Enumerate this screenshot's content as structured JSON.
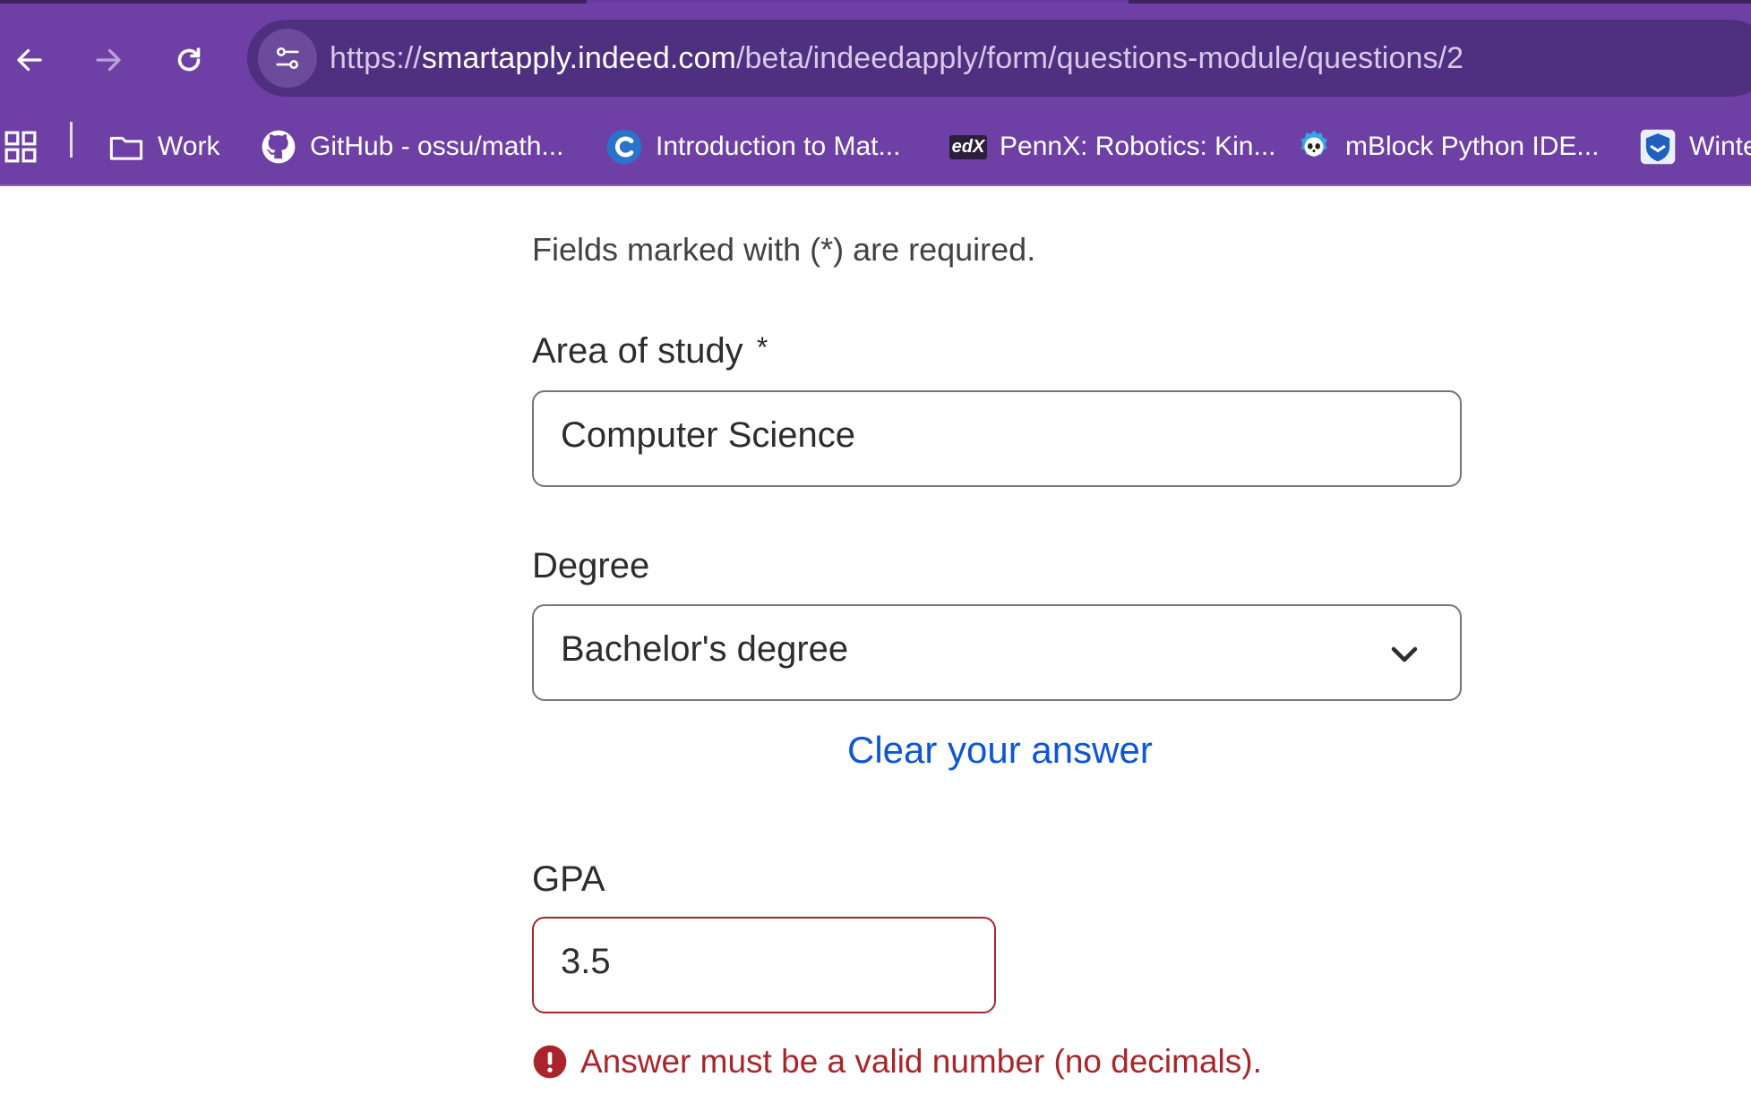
{
  "browser": {
    "url_prefix": "https://",
    "url_host": "smartapply.indeed.com",
    "url_path": "/beta/indeedapply/form/questions-module/questions/2",
    "bookmarks": [
      {
        "label": "Work",
        "icon": "folder-icon"
      },
      {
        "label": "GitHub - ossu/math...",
        "icon": "github-icon"
      },
      {
        "label": "Introduction to Mat...",
        "icon": "coursera-icon"
      },
      {
        "label": "PennX: Robotics: Kin...",
        "icon": "edx-icon"
      },
      {
        "label": "mBlock Python IDE...",
        "icon": "mblock-panda-icon"
      },
      {
        "label": "Winte",
        "icon": "shield-icon"
      }
    ],
    "edx_text": "edX"
  },
  "form": {
    "required_note": "Fields marked with (*) are required.",
    "area_of_study": {
      "label": "Area of study",
      "required_mark": "*",
      "value": "Computer Science"
    },
    "degree": {
      "label": "Degree",
      "selected": "Bachelor's degree",
      "clear_link": "Clear your answer"
    },
    "gpa": {
      "label": "GPA",
      "value": "3.5",
      "error": "Answer must be a valid number (no decimals)."
    }
  },
  "colors": {
    "chrome": "#6e40a6",
    "link": "#0d56d4",
    "error": "#a9252b"
  }
}
